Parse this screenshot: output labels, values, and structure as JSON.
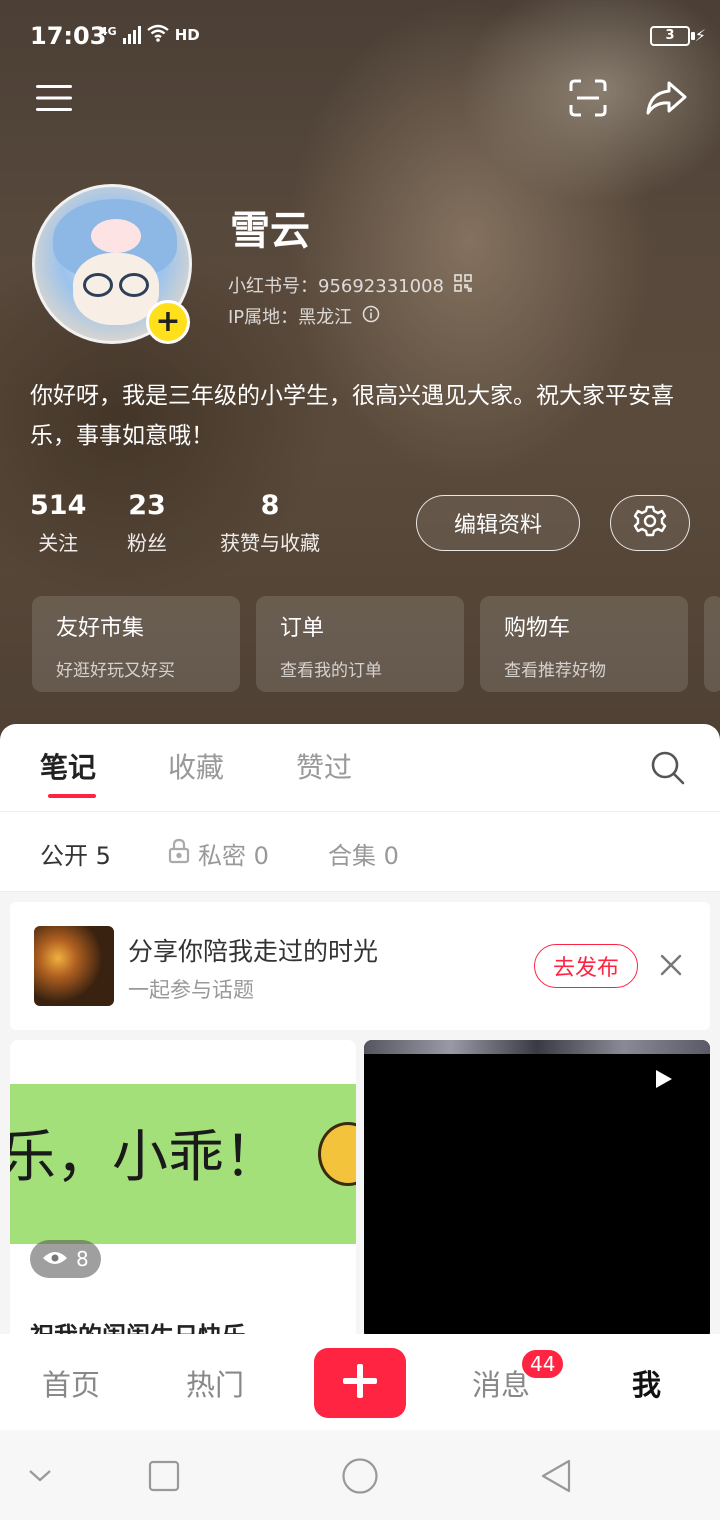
{
  "status_bar": {
    "time": "17:03",
    "network": "4G",
    "hd": "HD",
    "battery": "3"
  },
  "profile": {
    "name": "雪云",
    "id_text": "小红书号：95692331008",
    "ip_text": "IP属地：黑龙江",
    "bio": "你好呀，我是三年级的小学生，很高兴遇见大家。祝大家平安喜乐，事事如意哦！",
    "stats": [
      {
        "value": "514",
        "label": "关注"
      },
      {
        "value": "23",
        "label": "粉丝"
      },
      {
        "value": "8",
        "label": "获赞与收藏"
      }
    ],
    "edit_label": "编辑资料"
  },
  "cards": [
    {
      "title": "友好市集",
      "subtitle": "好逛好玩又好买"
    },
    {
      "title": "订单",
      "subtitle": "查看我的订单"
    },
    {
      "title": "购物车",
      "subtitle": "查看推荐好物"
    }
  ],
  "tabs": [
    "笔记",
    "收藏",
    "赞过"
  ],
  "subtabs": [
    {
      "label": "公开 5"
    },
    {
      "label": "私密 0"
    },
    {
      "label": "合集 0"
    }
  ],
  "promo": {
    "title": "分享你陪我走过的时光",
    "subtitle": "一起参与话题",
    "button": "去发布"
  },
  "notes": [
    {
      "image_text": "乐，小乖！",
      "views": "8",
      "title": "祝我的闺闺生日快乐"
    }
  ],
  "bottom_nav": {
    "home": "首页",
    "hot": "热门",
    "messages": "消息",
    "messages_badge": "44",
    "me": "我"
  },
  "colors": {
    "accent": "#ff2442",
    "avatar_badge": "#ffe01b"
  }
}
